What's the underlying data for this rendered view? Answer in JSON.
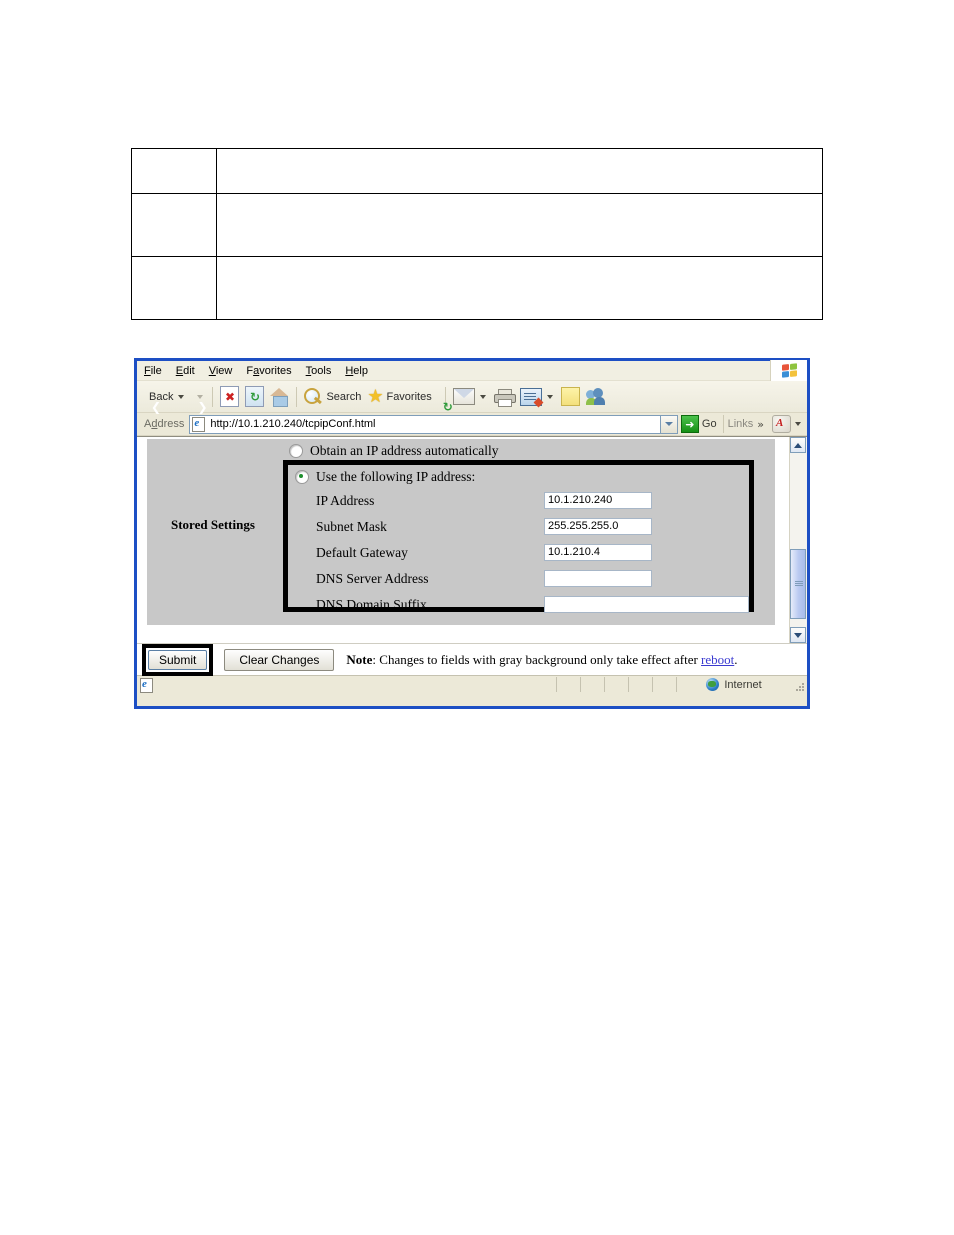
{
  "document_table": {
    "rows": [
      {
        "left": "",
        "right": ""
      },
      {
        "left": "",
        "right": ""
      },
      {
        "left": "",
        "right": "",
        "has_link_rule": true
      }
    ]
  },
  "browser": {
    "menu": [
      {
        "label": "File",
        "accel": "F"
      },
      {
        "label": "Edit",
        "accel": "E"
      },
      {
        "label": "View",
        "accel": "V"
      },
      {
        "label": "Favorites",
        "accel": "a"
      },
      {
        "label": "Tools",
        "accel": "T"
      },
      {
        "label": "Help",
        "accel": "H"
      }
    ],
    "toolbar": {
      "back_label": "Back",
      "forward_label": "",
      "stop_glyph": "✕",
      "refresh_glyph": "⟳",
      "home_label": "",
      "search_label": "Search",
      "favorites_label": "Favorites",
      "history_label": "",
      "mail_label": "",
      "print_label": "",
      "edit_label": "",
      "note_label": "",
      "messenger_label": ""
    },
    "address": {
      "label": "Address",
      "accel": "d",
      "url": "http://10.1.210.240/tcpipConf.html",
      "go_label": "Go",
      "links_label": "Links",
      "links_chevron": "»"
    },
    "status": {
      "zone_label": "Internet"
    }
  },
  "page": {
    "stored_settings_label": "Stored Settings",
    "radio_auto": {
      "label": "Obtain an IP address automatically",
      "checked": false
    },
    "radio_static": {
      "label": "Use the following IP address:",
      "checked": true
    },
    "fields": [
      {
        "label": "IP Address",
        "value": "10.1.210.240",
        "width": "small"
      },
      {
        "label": "Subnet Mask",
        "value": "255.255.255.0",
        "width": "small"
      },
      {
        "label": "Default Gateway",
        "value": "10.1.210.4",
        "width": "small"
      },
      {
        "label": "DNS Server Address",
        "value": "",
        "width": "small"
      },
      {
        "label": "DNS Domain Suffix",
        "value": "",
        "width": "wide"
      }
    ],
    "buttons": {
      "submit": "Submit",
      "clear": "Clear Changes"
    },
    "note": {
      "prefix": "Note",
      "colon": ": ",
      "body": "Changes to fields with gray background only take effect after ",
      "link": "reboot",
      "suffix": "."
    }
  },
  "colors": {
    "window_border": "#1d4fc4",
    "chrome_bg": "#ece9d8",
    "page_gray": "#c8c8c8",
    "link_blue": "#0000dd",
    "highlight_black": "#000000",
    "radio_dot_green": "#1f8f2f"
  }
}
